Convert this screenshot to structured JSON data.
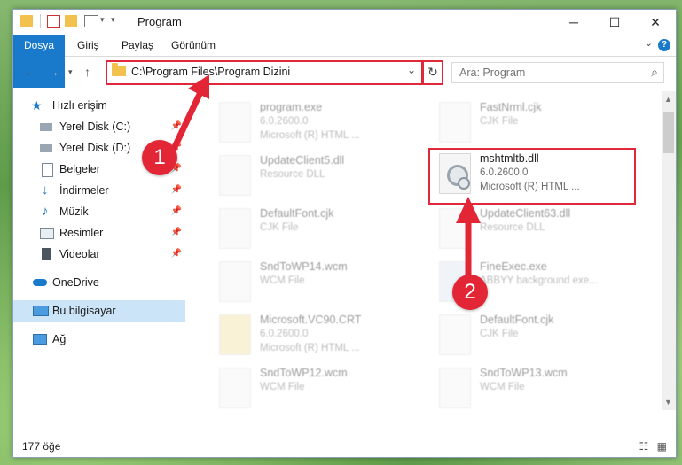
{
  "window": {
    "title": "Program"
  },
  "ribbon": {
    "tabs": [
      "Dosya",
      "Giriş",
      "Paylaş",
      "Görünüm"
    ],
    "help": "?"
  },
  "address": {
    "path": "C:\\Program Files\\Program Dizini"
  },
  "search": {
    "placeholder": "Ara: Program"
  },
  "sidebar": {
    "items": [
      {
        "label": "Hızlı erişim",
        "icon": "star-icon"
      },
      {
        "label": "Yerel Disk (C:)",
        "icon": "drive-icon"
      },
      {
        "label": "Yerel Disk (D:)",
        "icon": "drive-icon"
      },
      {
        "label": "Belgeler",
        "icon": "document-icon"
      },
      {
        "label": "İndirmeler",
        "icon": "download-icon"
      },
      {
        "label": "Müzik",
        "icon": "music-icon"
      },
      {
        "label": "Resimler",
        "icon": "pictures-icon"
      },
      {
        "label": "Videolar",
        "icon": "video-icon"
      },
      {
        "label": "OneDrive",
        "icon": "cloud-icon"
      },
      {
        "label": "Bu bilgisayar",
        "icon": "computer-icon"
      },
      {
        "label": "Ağ",
        "icon": "network-icon"
      }
    ]
  },
  "files": [
    {
      "name": "program.exe",
      "line2": "6.0.2600.0",
      "line3": "Microsoft (R) HTML ..."
    },
    {
      "name": "FastNrml.cjk",
      "line2": "CJK File",
      "line3": ""
    },
    {
      "name": "UpdateClient5.dll",
      "line2": "Resource DLL",
      "line3": ""
    },
    {
      "name": "mshtmltb.dll",
      "line2": "6.0.2600.0",
      "line3": "Microsoft (R) HTML ..."
    },
    {
      "name": "DefaultFont.cjk",
      "line2": "CJK File",
      "line3": ""
    },
    {
      "name": "UpdateClient63.dll",
      "line2": "Resource DLL",
      "line3": ""
    },
    {
      "name": "SndToWP14.wcm",
      "line2": "WCM File",
      "line3": ""
    },
    {
      "name": "FineExec.exe",
      "line2": "ABBYY background exe...",
      "line3": ""
    },
    {
      "name": "Microsoft.VC90.CRT",
      "line2": "6.0.2600.0",
      "line3": "Microsoft (R) HTML ..."
    },
    {
      "name": "DefaultFont.cjk",
      "line2": "CJK File",
      "line3": ""
    },
    {
      "name": "SndToWP12.wcm",
      "line2": "WCM File",
      "line3": ""
    },
    {
      "name": "SndToWP13.wcm",
      "line2": "WCM File",
      "line3": ""
    }
  ],
  "status": {
    "count": "177 öğe"
  },
  "callouts": [
    "1",
    "2"
  ],
  "colors": {
    "accent": "#1979ca",
    "highlight": "#e0283a"
  }
}
